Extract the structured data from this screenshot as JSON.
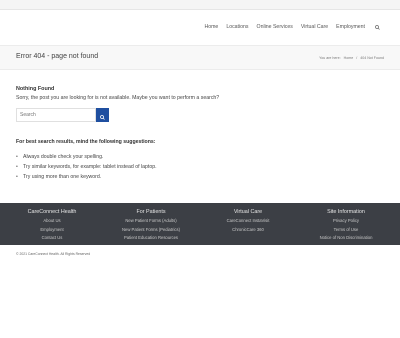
{
  "nav": {
    "items": [
      "Home",
      "Locations",
      "Online Services",
      "Virtual Care",
      "Employment"
    ]
  },
  "titlebar": {
    "title": "Error 404 - page not found",
    "breadcrumb_prefix": "You are here:",
    "breadcrumb_home": "Home",
    "breadcrumb_sep": "/",
    "breadcrumb_current": "404 Not Found"
  },
  "notfound": {
    "heading": "Nothing Found",
    "text": "Sorry, the post you are looking for is not available. Maybe you want to perform a search?"
  },
  "search": {
    "placeholder": "Search"
  },
  "tips": {
    "heading": "For best search results, mind the following suggestions:",
    "items": [
      "Always double check your spelling.",
      "Try similar keywords, for example: tablet instead of laptop.",
      "Try using more than one keyword."
    ]
  },
  "footer": {
    "columns": [
      {
        "title": "CareConnect Health",
        "links": [
          "About Us",
          "Employment",
          "Contact Us"
        ]
      },
      {
        "title": "For Patients",
        "links": [
          "New Patient Forms (Adults)",
          "New Patient Forms (Pediatrics)",
          "Patient Education Resources"
        ]
      },
      {
        "title": "Virtual Care",
        "links": [
          "CareConnect InstaVisit",
          "ChronicCare 360"
        ]
      },
      {
        "title": "Site Information",
        "links": [
          "Privacy Policy",
          "Terms of Use",
          "Notice of Non Discrimination"
        ]
      }
    ]
  },
  "copyright": "© 2021 CareConnect Health. All Rights Reserved",
  "colors": {
    "accent": "#1f4fa0",
    "footer_bg": "#3c3f45"
  },
  "icons": [
    "search-icon"
  ]
}
